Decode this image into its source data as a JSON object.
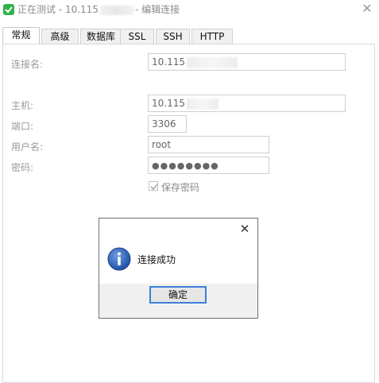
{
  "window": {
    "title_prefix": "正在测试 - 10.115",
    "title_suffix": "- 编辑连接",
    "close_glyph": "✕"
  },
  "tabs": [
    {
      "label": "常规",
      "active": true
    },
    {
      "label": "高级",
      "active": false
    },
    {
      "label": "数据库",
      "active": false
    },
    {
      "label": "SSL",
      "active": false
    },
    {
      "label": "SSH",
      "active": false
    },
    {
      "label": "HTTP",
      "active": false
    }
  ],
  "form": {
    "connection_name_label": "连接名:",
    "connection_name_value": "10.115",
    "host_label": "主机:",
    "host_value": "10.115",
    "port_label": "端口:",
    "port_value": "3306",
    "username_label": "用户名:",
    "username_value": "root",
    "password_label": "密码:",
    "password_mask": "●●●●●●●●",
    "save_password_label": "保存密码",
    "save_password_checked": true
  },
  "dialog": {
    "close_glyph": "✕",
    "message": "连接成功",
    "ok_label": "确定",
    "icon": "info-icon"
  },
  "colors": {
    "accent": "#3c7fd9",
    "app_icon": "#2fb24c",
    "info_icon": "#2b5fb3"
  }
}
